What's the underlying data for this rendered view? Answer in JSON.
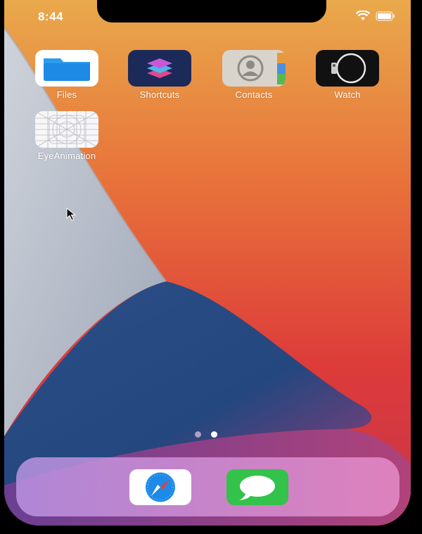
{
  "status_bar": {
    "time": "8:44"
  },
  "apps": [
    {
      "label": "Files",
      "icon": "folder-icon"
    },
    {
      "label": "Shortcuts",
      "icon": "shortcuts-icon"
    },
    {
      "label": "Contacts",
      "icon": "contacts-icon"
    },
    {
      "label": "Watch",
      "icon": "watch-icon"
    },
    {
      "label": "EyeAnimation",
      "icon": "app-grid-icon"
    }
  ],
  "page_indicator": {
    "pages": 2,
    "current": 2
  },
  "dock": {
    "apps": [
      {
        "icon": "safari-icon"
      },
      {
        "icon": "messages-icon"
      }
    ]
  },
  "colors": {
    "dot_active": "#ffffff",
    "dot_inactive": "#c9b6d8"
  }
}
